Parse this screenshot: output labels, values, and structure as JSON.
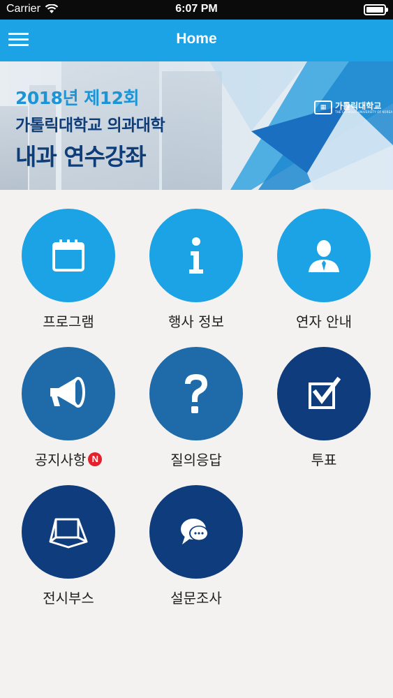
{
  "status_bar": {
    "carrier": "Carrier",
    "time": "6:07 PM",
    "icons": [
      "wifi-icon",
      "battery-icon"
    ]
  },
  "nav": {
    "title": "Home",
    "menu_icon": "hamburger-menu-icon"
  },
  "banner": {
    "line1": "2018년 제12회",
    "line2": "가톨릭대학교 의과대학",
    "line3": "내과 연수강좌",
    "logo_text": "가톨릭대학교",
    "logo_subtext": "THE CATHOLIC UNIVERSITY OF KOREA"
  },
  "menu": {
    "items": [
      {
        "label": "프로그램",
        "icon": "calendar-icon",
        "color": "#1ba3e6"
      },
      {
        "label": "행사 정보",
        "icon": "info-icon",
        "color": "#1ba3e6"
      },
      {
        "label": "연자 안내",
        "icon": "speaker-person-icon",
        "color": "#1ba3e6"
      },
      {
        "label": "공지사항",
        "icon": "megaphone-icon",
        "color": "#1f6aa8",
        "badge": "N"
      },
      {
        "label": "질의응답",
        "icon": "question-icon",
        "color": "#1f6aa8"
      },
      {
        "label": "투표",
        "icon": "vote-check-icon",
        "color": "#0e3c7c"
      },
      {
        "label": "전시부스",
        "icon": "booth-icon",
        "color": "#0e3c7c"
      },
      {
        "label": "설문조사",
        "icon": "chat-bubble-icon",
        "color": "#0e3c7c"
      }
    ]
  },
  "colors": {
    "nav_blue": "#1ba3e6",
    "mid_blue": "#1f6aa8",
    "dark_blue": "#0e3c7c",
    "badge_red": "#e3202c"
  }
}
